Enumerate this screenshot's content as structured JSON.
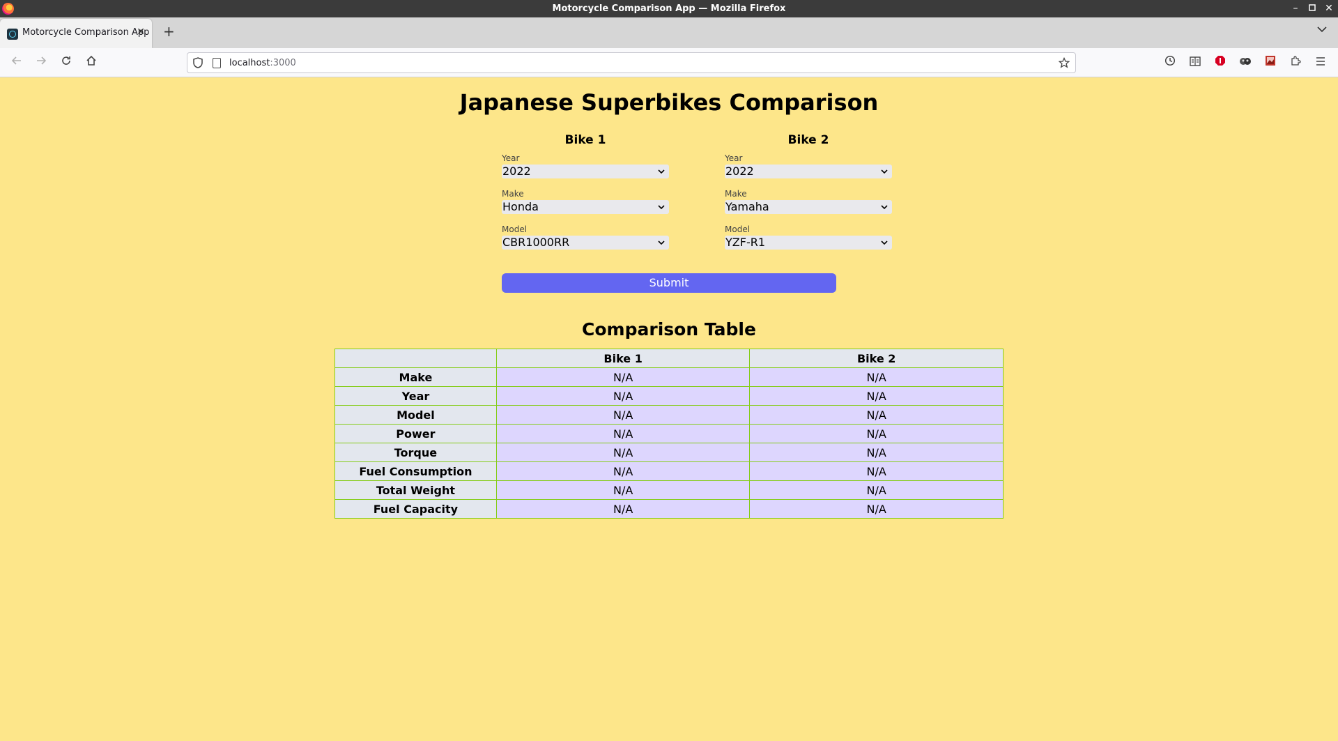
{
  "window": {
    "title": "Motorcycle Comparison App — Mozilla Firefox",
    "controls": {
      "minimize": "–",
      "maximize": "▫",
      "close": "✕"
    }
  },
  "browser": {
    "tab": {
      "title": "Motorcycle Comparison App",
      "close": "✕"
    },
    "new_tab": "+",
    "tab_list": "⌄",
    "url_host": "localhost",
    "url_port": ":3000",
    "icons": {
      "back": "back-arrow-icon",
      "forward": "forward-arrow-icon",
      "reload": "reload-icon",
      "home": "home-icon",
      "bookmark": "star-icon",
      "history": "history-icon",
      "reader": "reader-view-icon",
      "extensions": "puzzle-icon",
      "menu": "hamburger-menu-icon"
    }
  },
  "page": {
    "title": "Japanese Superbikes Comparison",
    "bike1": {
      "heading": "Bike 1",
      "year_label": "Year",
      "year_value": "2022",
      "make_label": "Make",
      "make_value": "Honda",
      "model_label": "Model",
      "model_value": "CBR1000RR"
    },
    "bike2": {
      "heading": "Bike 2",
      "year_label": "Year",
      "year_value": "2022",
      "make_label": "Make",
      "make_value": "Yamaha",
      "model_label": "Model",
      "model_value": "YZF-R1"
    },
    "submit_label": "Submit",
    "table": {
      "title": "Comparison Table",
      "headers": [
        "",
        "Bike 1",
        "Bike 2"
      ],
      "rows": [
        {
          "label": "Make",
          "bike1": "N/A",
          "bike2": "N/A"
        },
        {
          "label": "Year",
          "bike1": "N/A",
          "bike2": "N/A"
        },
        {
          "label": "Model",
          "bike1": "N/A",
          "bike2": "N/A"
        },
        {
          "label": "Power",
          "bike1": "N/A",
          "bike2": "N/A"
        },
        {
          "label": "Torque",
          "bike1": "N/A",
          "bike2": "N/A"
        },
        {
          "label": "Fuel Consumption",
          "bike1": "N/A",
          "bike2": "N/A"
        },
        {
          "label": "Total Weight",
          "bike1": "N/A",
          "bike2": "N/A"
        },
        {
          "label": "Fuel Capacity",
          "bike1": "N/A",
          "bike2": "N/A"
        }
      ]
    }
  },
  "colors": {
    "page_background": "#fde68a",
    "submit_button": "#6366f1",
    "table_border": "#84cc16",
    "table_value_cell": "#ddd6fe",
    "table_label_cell": "#e3e7ee"
  }
}
